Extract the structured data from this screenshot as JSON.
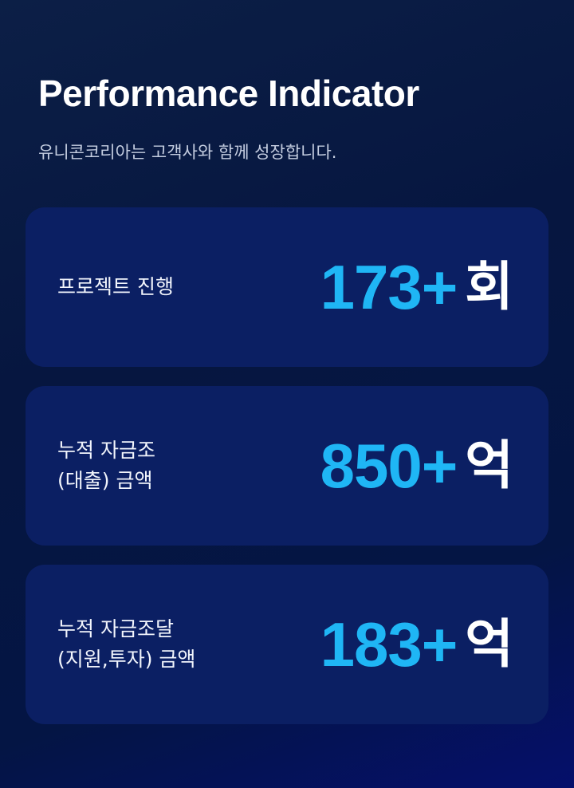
{
  "header": {
    "title": "Performance Indicator",
    "subtitle": "유니콘코리아는 고객사와 함께 성장합니다."
  },
  "indicators": [
    {
      "label_lines": [
        "프로젝트 진행"
      ],
      "value": "173+",
      "unit": "회"
    },
    {
      "label_lines": [
        "누적 자금조",
        "(대출) 금액"
      ],
      "value": "850+",
      "unit": "억"
    },
    {
      "label_lines": [
        "누적 자금조달",
        "(지원,투자) 금액"
      ],
      "value": "183+",
      "unit": "억"
    }
  ],
  "colors": {
    "background": "#061640",
    "card": "#0b1f63",
    "accent": "#1fb6f5",
    "text": "#ffffff",
    "subtitle": "#c4cde0"
  }
}
